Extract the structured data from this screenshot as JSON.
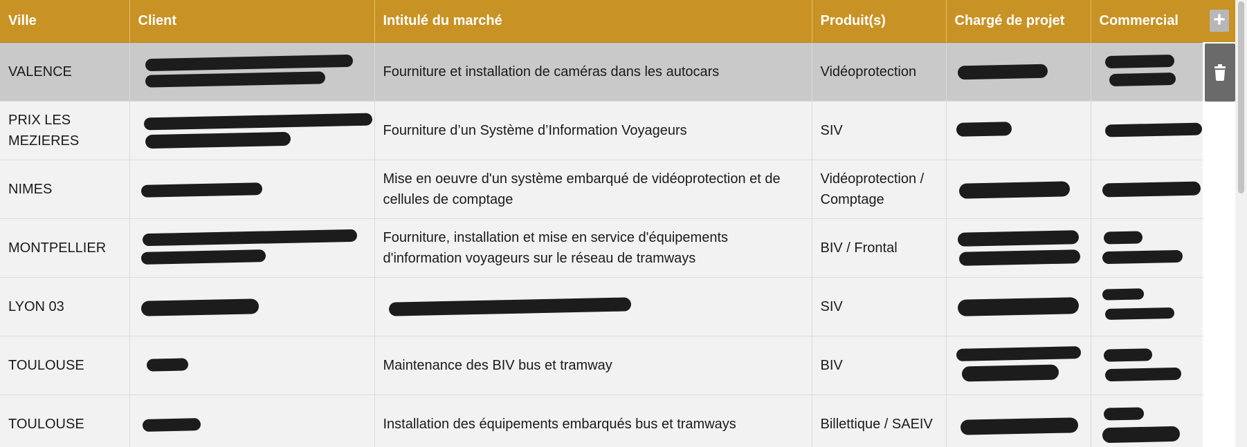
{
  "table": {
    "headers": {
      "ville": "Ville",
      "client": "Client",
      "intitule": "Intitulé du marché",
      "produits": "Produit(s)",
      "charge": "Chargé de projet",
      "commercial": "Commercial"
    },
    "rows": [
      {
        "ville": "VALENCE",
        "intitule": "Fourniture et installation de caméras dans les autocars",
        "produits": "Vidéoprotection",
        "selected": true
      },
      {
        "ville": "PRIX LES MEZIERES",
        "intitule": "Fourniture d’un Système d’Information Voyageurs",
        "produits": "SIV"
      },
      {
        "ville": "NIMES",
        "intitule": "Mise en oeuvre d'un système embarqué de vidéoprotection et de cellules de comptage",
        "produits": "Vidéoprotection / Comptage"
      },
      {
        "ville": "MONTPELLIER",
        "intitule": "Fourniture, installation et mise en service d'équipements d'information voyageurs sur le réseau de tramways",
        "produits": "BIV / Frontal"
      },
      {
        "ville": "LYON 03",
        "intitule": "",
        "produits": "SIV"
      },
      {
        "ville": "TOULOUSE",
        "intitule": "Maintenance des BIV bus et tramway",
        "produits": "BIV"
      },
      {
        "ville": "TOULOUSE",
        "intitule": "Installation des équipements embarqués bus et tramways",
        "produits": "Billettique / SAEIV"
      }
    ]
  },
  "actions": {
    "add_label": "+",
    "add_icon": "plus-icon",
    "delete_icon": "trash-icon"
  },
  "colors": {
    "header": "#c99224",
    "row": "#f2f2f2",
    "row_selected": "#c9c9c9",
    "delete_button": "#6a6a6a"
  }
}
